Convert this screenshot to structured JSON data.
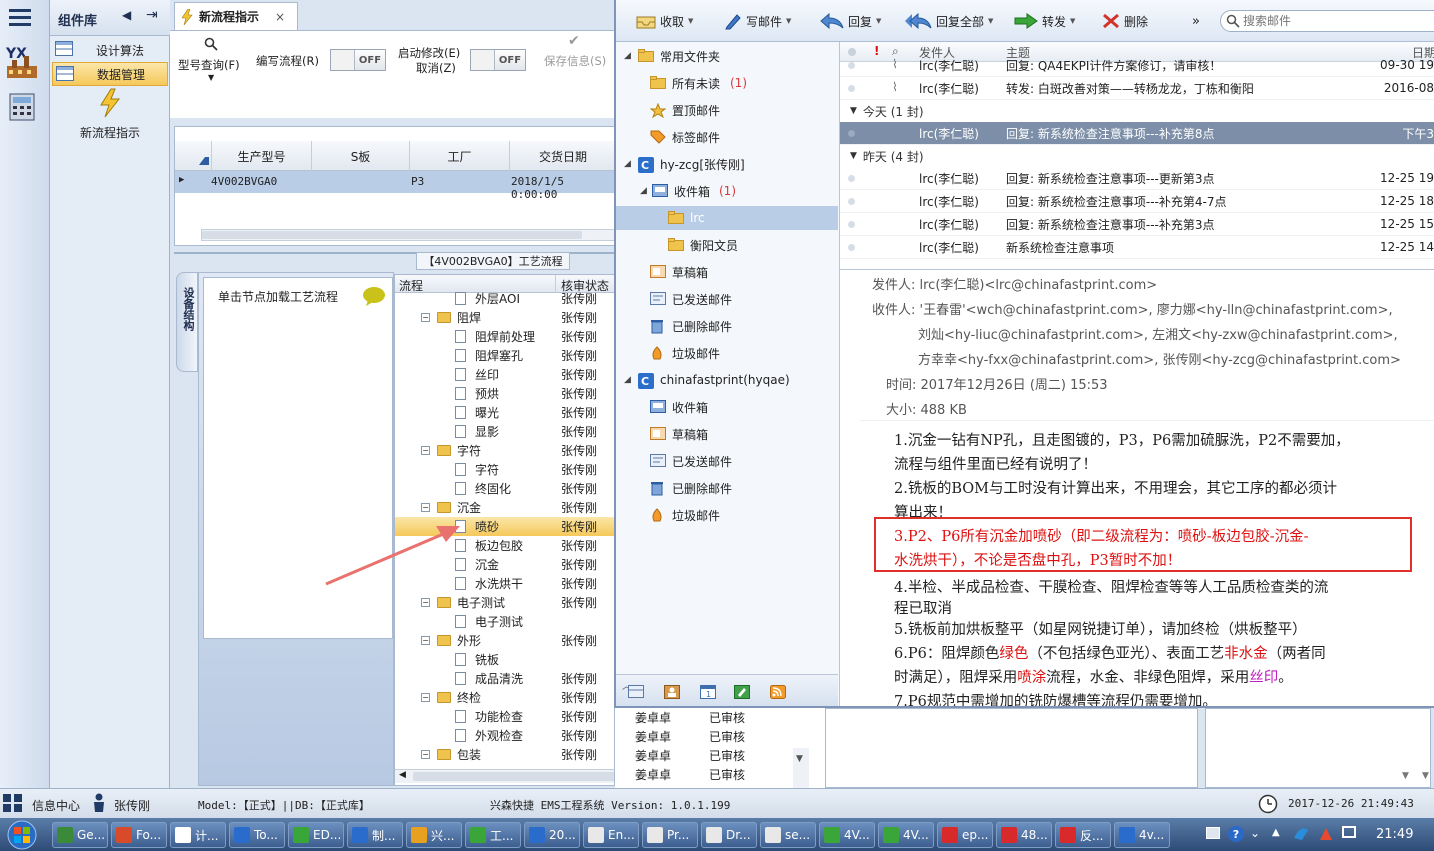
{
  "rail": {
    "logo_text": "YX"
  },
  "complib": {
    "title": "组件库",
    "items": [
      {
        "label": "设计算法"
      },
      {
        "label": "数据管理"
      }
    ],
    "new_flow_label": "新流程指示"
  },
  "app_tab": {
    "label": "新流程指示",
    "close": "×"
  },
  "toolbar": {
    "query": "型号查询(F)",
    "write": "编写流程(R)",
    "toggle1": "OFF",
    "start_modify": "启动修改(E)",
    "cancel": "取消(Z)",
    "toggle2": "OFF",
    "save": "保存信息(S)"
  },
  "grid": {
    "headers": [
      "生产型号",
      "S板",
      "工厂",
      "交货日期"
    ],
    "rows": [
      [
        "4V002BVGA0",
        "",
        "P3",
        "2018/1/5 0:00:00"
      ]
    ]
  },
  "process": {
    "title": "【4V002BVGA0】工艺流程",
    "side_tab": "设备结构",
    "hint": "单击节点加载工艺流程",
    "col_flow": "流程",
    "col_status": "核审状态",
    "nodes": [
      {
        "name": "外层AOI",
        "status": "张传刚",
        "depth": 2,
        "folder": false
      },
      {
        "name": "阻焊",
        "status": "张传刚",
        "depth": 1,
        "folder": true
      },
      {
        "name": "阻焊前处理",
        "status": "张传刚",
        "depth": 2,
        "folder": false
      },
      {
        "name": "阻焊塞孔",
        "status": "张传刚",
        "depth": 2,
        "folder": false
      },
      {
        "name": "丝印",
        "status": "张传刚",
        "depth": 2,
        "folder": false
      },
      {
        "name": "预烘",
        "status": "张传刚",
        "depth": 2,
        "folder": false
      },
      {
        "name": "曝光",
        "status": "张传刚",
        "depth": 2,
        "folder": false
      },
      {
        "name": "显影",
        "status": "张传刚",
        "depth": 2,
        "folder": false
      },
      {
        "name": "字符",
        "status": "张传刚",
        "depth": 1,
        "folder": true
      },
      {
        "name": "字符",
        "status": "张传刚",
        "depth": 2,
        "folder": false
      },
      {
        "name": "终固化",
        "status": "张传刚",
        "depth": 2,
        "folder": false
      },
      {
        "name": "沉金",
        "status": "张传刚",
        "depth": 1,
        "folder": true
      },
      {
        "name": "喷砂",
        "status": "张传刚",
        "depth": 2,
        "folder": false
      },
      {
        "name": "板边包胶",
        "status": "张传刚",
        "depth": 2,
        "folder": false
      },
      {
        "name": "沉金",
        "status": "张传刚",
        "depth": 2,
        "folder": false
      },
      {
        "name": "水洗烘干",
        "status": "张传刚",
        "depth": 2,
        "folder": false
      },
      {
        "name": "电子测试",
        "status": "张传刚",
        "depth": 1,
        "folder": true
      },
      {
        "name": "电子测试",
        "status": "",
        "depth": 2,
        "folder": false
      },
      {
        "name": "外形",
        "status": "张传刚",
        "depth": 1,
        "folder": true
      },
      {
        "name": "铣板",
        "status": "",
        "depth": 2,
        "folder": false
      },
      {
        "name": "成品清洗",
        "status": "张传刚",
        "depth": 2,
        "folder": false
      },
      {
        "name": "终检",
        "status": "张传刚",
        "depth": 1,
        "folder": true
      },
      {
        "name": "功能检查",
        "status": "张传刚",
        "depth": 2,
        "folder": false
      },
      {
        "name": "外观检查",
        "status": "张传刚",
        "depth": 2,
        "folder": false
      },
      {
        "name": "包装",
        "status": "张传刚",
        "depth": 1,
        "folder": true
      }
    ],
    "extra_rows": [
      [
        "姜卓卓",
        "已审核"
      ],
      [
        "姜卓卓",
        "已审核"
      ],
      [
        "姜卓卓",
        "已审核"
      ],
      [
        "姜卓卓",
        "已审核"
      ]
    ]
  },
  "mail": {
    "toolbar": {
      "receive": "收取",
      "compose": "写邮件",
      "reply": "回复",
      "reply_all": "回复全部",
      "forward": "转发",
      "delete": "删除",
      "more": "»",
      "search_placeholder": "搜索邮件"
    },
    "folders": [
      {
        "label": "常用文件夹",
        "unread": "",
        "level": 0
      },
      {
        "label": "所有未读",
        "unread": "(1)",
        "level": 1
      },
      {
        "label": "置顶邮件",
        "unread": "",
        "level": 1
      },
      {
        "label": "标签邮件",
        "unread": "",
        "level": 1
      },
      {
        "label": "hy-zcg[张传刚]",
        "unread": "",
        "level": 0
      },
      {
        "label": "收件箱",
        "unread": "(1)",
        "level": 1
      },
      {
        "label": "lrc",
        "unread": "",
        "level": 2
      },
      {
        "label": "衡阳文员",
        "unread": "",
        "level": 2
      },
      {
        "label": "草稿箱",
        "unread": "",
        "level": 1
      },
      {
        "label": "已发送邮件",
        "unread": "",
        "level": 1
      },
      {
        "label": "已删除邮件",
        "unread": "",
        "level": 1
      },
      {
        "label": "垃圾邮件",
        "unread": "",
        "level": 1
      },
      {
        "label": "chinafastprint(hyqae)",
        "unread": "",
        "level": 0
      },
      {
        "label": "收件箱",
        "unread": "",
        "level": 1
      },
      {
        "label": "草稿箱",
        "unread": "",
        "level": 1
      },
      {
        "label": "已发送邮件",
        "unread": "",
        "level": 1
      },
      {
        "label": "已删除邮件",
        "unread": "",
        "level": 1
      },
      {
        "label": "垃圾邮件",
        "unread": "",
        "level": 1
      }
    ],
    "list_headers": {
      "flag": "!",
      "from": "发件人",
      "subject": "主题",
      "date": "日期"
    },
    "messages_top": [
      {
        "from": "lrc(李仁聪)",
        "subject": "回复: QA4EKPI计件方案修订，请审核！",
        "date": "09-30 19"
      },
      {
        "from": "lrc(李仁聪)",
        "subject": "转发: 白斑改善对策——转杨龙龙，丁栋和衡阳",
        "date": "2016-08"
      }
    ],
    "group_today": "今天 (1 封)",
    "messages_today": [
      {
        "from": "lrc(李仁聪)",
        "subject": "回复: 新系统检查注意事项---补充第8点",
        "date": "下午3"
      }
    ],
    "group_yesterday": "昨天 (4 封)",
    "messages_yesterday": [
      {
        "from": "lrc(李仁聪)",
        "subject": "回复: 新系统检查注意事项---更新第3点",
        "date": "12-25 19"
      },
      {
        "from": "lrc(李仁聪)",
        "subject": "回复: 新系统检查注意事项---补充第4-7点",
        "date": "12-25 18"
      },
      {
        "from": "lrc(李仁聪)",
        "subject": "回复: 新系统检查注意事项---补充第3点",
        "date": "12-25 15"
      },
      {
        "from": "lrc(李仁聪)",
        "subject": "新系统检查注意事项",
        "date": "12-25 14"
      }
    ],
    "preview": {
      "from": "发件人: lrc(李仁聪)<lrc@chinafastprint.com>",
      "to1": "收件人: '王春雷'<wch@chinafastprint.com>, 廖力娜<hy-lln@chinafastprint.com>,",
      "to2": "刘灿<hy-liuc@chinafastprint.com>, 左湘文<hy-zxw@chinafastprint.com>,",
      "to3": "方幸幸<hy-fxx@chinafastprint.com>, 张传刚<hy-zcg@chinafastprint.com>",
      "time": "时间: 2017年12月26日 (周二) 15:53",
      "size": "大小: 488 KB",
      "p1a": "1.沉金一钻有NP孔，且走图镀的，P3，P6需加硫脲洗，P2不需要加，",
      "p1b": "流程与组件里面已经有说明了！",
      "p2a": "2.铣板的BOM与工时没有计算出来，不用理会，其它工序的都必须计",
      "p2b": "算出来！",
      "p3a": "3.P2、P6所有沉金加喷砂（即二级流程为：喷砂-板边包胶-沉金-",
      "p3b": "水洗烘干），不论是否盘中孔，P3暂时不加！",
      "p4a": "4.半检、半成品检查、干膜检查、阻焊检查等等人工品质检查类的流",
      "p4b": "程已取消",
      "p5": "5.铣板前加烘板整平（如星网锐捷订单），请加终检（烘板整平）",
      "p6a1": "6.P6：阻焊颜色",
      "p6a2": "绿色",
      "p6a3": "（不包括绿色亚光）、表面工艺",
      "p6a4": "非水金",
      "p6a5": "（两者同",
      "p6b1": "时满足），阻焊采用",
      "p6b2": "喷涂",
      "p6b3": "流程，水金、非绿色阻焊，采用",
      "p6b4": "丝印",
      "p6b5": "。",
      "p7": "7.P6规范中需增加的铣防爆槽等流程仍需要增加。"
    }
  },
  "status": {
    "info_center": "信息中心",
    "user": "张传刚",
    "model": "Model:【正式】||DB:【正式库】",
    "system": "兴森快捷 EMS工程系统 Version: 1.0.1.199",
    "datetime": "2017-12-26 21:49:43"
  },
  "taskbar": {
    "items": [
      "Ge...",
      "Fo...",
      "计...",
      "To...",
      "ED...",
      "制...",
      "兴...",
      "工...",
      "20...",
      "En...",
      "Pr...",
      "Dr...",
      "se...",
      "4V...",
      "4V...",
      "ep...",
      "48...",
      "反...",
      "4v..."
    ],
    "time": "21:49"
  },
  "colors": {
    "accent_orange": "#f5c85a",
    "selection_blue": "#b9cde6",
    "mail_selected": "#7d8fa8",
    "annotation_red": "#e0302c"
  }
}
